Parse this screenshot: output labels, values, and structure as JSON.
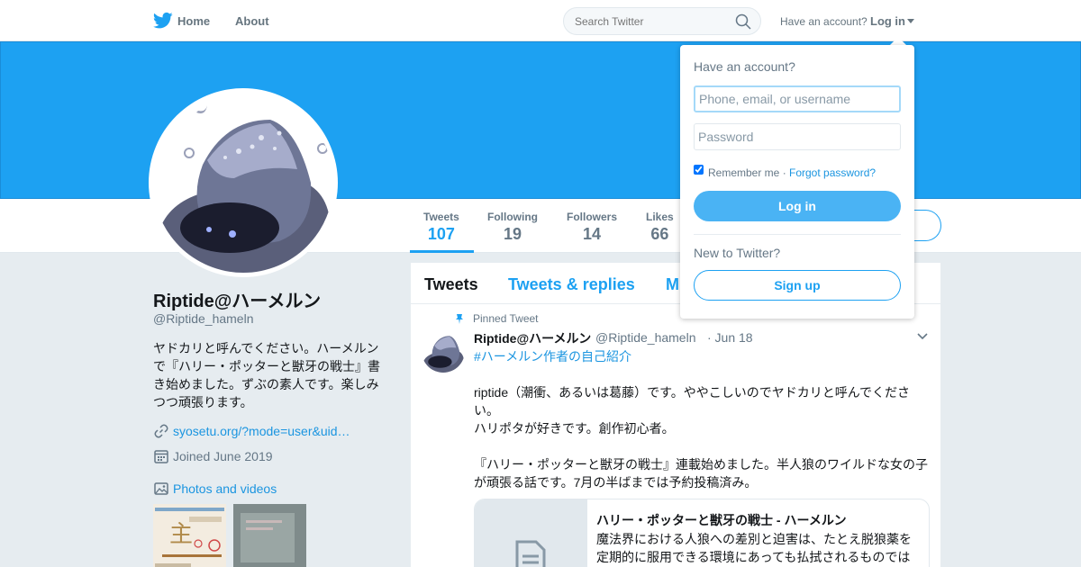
{
  "topnav": {
    "home_label": "Home",
    "about_label": "About",
    "search_placeholder": "Search Twitter",
    "have_account": "Have an account?",
    "login_label": "Log in"
  },
  "profile": {
    "display_name": "Riptide@ハーメルン",
    "handle": "@Riptide_hameln",
    "bio": "ヤドカリと呼んでください。ハーメルンで『ハリー・ポッターと獣牙の戦士』書き始めました。ずぶの素人です。楽しみつつ頑張ります。",
    "url": "syosetu.org/?mode=user&uid…",
    "joined": "Joined June 2019",
    "photos_label": "Photos and videos"
  },
  "stats": [
    {
      "label": "Tweets",
      "value": "107"
    },
    {
      "label": "Following",
      "value": "19"
    },
    {
      "label": "Followers",
      "value": "14"
    },
    {
      "label": "Likes",
      "value": "66"
    }
  ],
  "timeline": {
    "tabs": [
      "Tweets",
      "Tweets & replies",
      "M"
    ],
    "pinned_label": "Pinned Tweet",
    "tweet": {
      "name": "Riptide@ハーメルン",
      "handle": "@Riptide_hameln",
      "date": "· Jun 18",
      "hashtag": "#ハーメルン作者の自己紹介",
      "text_line1": "riptide（潮衝、あるいは葛藤）です。ややこしいのでヤドカリと呼んでください。",
      "text_line2": "ハリポタが好きです。創作初心者。",
      "text_line3": "『ハリー・ポッターと獣牙の戦士』連載始めました。半人狼のワイルドな女の子が頑張る話です。7月の半ばまでは予約投稿済み。",
      "card_title": "ハリー・ポッターと獣牙の戦士 - ハーメルン",
      "card_desc": "魔法界における人狼への差別と迫害は、たとえ脱狼薬を定期的に服用できる環境にあっても払拭されるものではない。"
    }
  },
  "login_dropdown": {
    "heading": "Have an account?",
    "username_placeholder": "Phone, email, or username",
    "password_placeholder": "Password",
    "remember": "Remember me ·",
    "forgot": "Forgot password?",
    "login_button": "Log in",
    "new_to": "New to Twitter?",
    "signup_button": "Sign up"
  },
  "colors": {
    "brand": "#1da1f2",
    "link": "#1b95e0",
    "muted": "#657786"
  }
}
